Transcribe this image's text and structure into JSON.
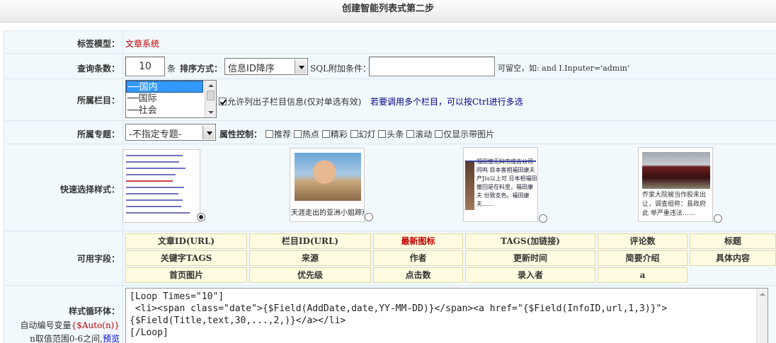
{
  "header": {
    "title": "创建智能列表式第二步"
  },
  "tag_model": {
    "label": "标签模型：",
    "value": "文章系统"
  },
  "query": {
    "label": "查询条数：",
    "count_value": "10",
    "count_unit": "条",
    "sort_label": "排序方式：",
    "sort_value": "信息ID降序",
    "sql_label": "SQL附加条件：",
    "sql_value": "",
    "sql_hint": "可留空，如: and I.Inputer='admin'"
  },
  "category": {
    "label": "所属栏目：",
    "options": [
      "──国内",
      "──国际",
      "──社会"
    ],
    "allow_child_label": "允许列出子栏目信息(仅对单选有效)",
    "multi_hint": "若要调用多个栏目，可以按Ctrl进行多选"
  },
  "special": {
    "label": "所属专题：",
    "value": "-不指定专题-",
    "attr_label": "属性控制：",
    "attrs": [
      "推荐",
      "热点",
      "精彩",
      "幻灯",
      "头条",
      "滚动",
      "仅显示带图片"
    ]
  },
  "styles": {
    "label": "快速选择样式：",
    "thumb2_caption": "天涯走出的亚洲小姐蹄燕",
    "thumb3_text": "福田撤无料市成吉公司同鸣 目本客相福田康夫产Jiu以上可 日本相福田撤回是在料里，福田康夫 份致支色。福田康夫……",
    "thumb4_text": "乔家大院被当作胶来出 让，调查组称：县政府此 举严重违法……"
  },
  "fields": {
    "label": "可用字段：",
    "items": [
      "文章ID(URL)",
      "栏目ID(URL)",
      "最新图标",
      "TAGS(加链接)",
      "评论数",
      "标题",
      "关键字TAGS",
      "来源",
      "作者",
      "更新时间",
      "简要介绍",
      "具体内容",
      "首页图片",
      "优先级",
      "点击数",
      "录入者",
      "a"
    ],
    "highlight_color": "#c00000"
  },
  "loop": {
    "label": "样式循环体：",
    "auto_label": "自动编号变量",
    "auto_var": "{$Auto(n)}",
    "range_text": "n取值范围0-6之间,",
    "preview_link": "预览",
    "code_lines": [
      "[Loop Times=\"10\"]",
      " <li><span class=\"date\">{$Field(AddDate,date,YY-MM-DD)}</span><a href=\"{$Field(InfoID,url,1,3)}\">",
      "{$Field(Title,text,30,...,2,)}</a></li>",
      "[/Loop]"
    ]
  }
}
